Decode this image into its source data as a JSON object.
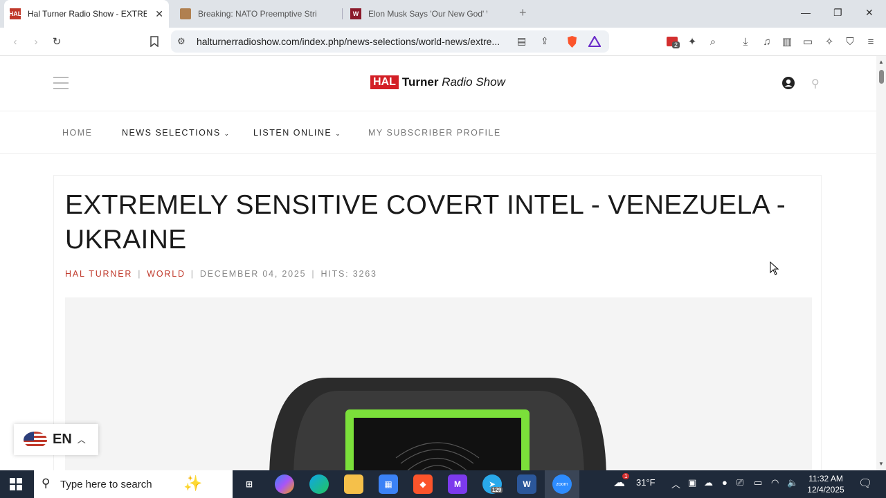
{
  "browser": {
    "tabs": [
      {
        "title": "Hal Turner Radio Show - EXTREMELY",
        "favicon": "HAL",
        "active": true
      },
      {
        "title": "Breaking: NATO Preemptive Strike on",
        "favicon": "",
        "active": false
      },
      {
        "title": "Elon Musk Says 'Our New God' Will C",
        "favicon": "W",
        "active": false
      }
    ],
    "url": "halturnerradioshow.com/index.php/news-selections/world-news/extre...",
    "extension_badge": "2"
  },
  "site": {
    "logo_box": "HAL",
    "logo_name": "Turner",
    "logo_suffix": "Radio Show",
    "nav": [
      {
        "label": "HOME"
      },
      {
        "label": "NEWS SELECTIONS"
      },
      {
        "label": "LISTEN ONLINE"
      },
      {
        "label": "MY SUBSCRIBER PROFILE"
      }
    ]
  },
  "article": {
    "title": "EXTREMELY SENSITIVE COVERT INTEL - VENEZUELA - UKRAINE",
    "author": "HAL TURNER",
    "category": "WORLD",
    "date": "DECEMBER 04, 2025",
    "hits": "HITS: 3263"
  },
  "language_widget": {
    "code": "EN"
  },
  "taskbar": {
    "search_placeholder": "Type here to search",
    "temperature": "31°F",
    "time": "11:32 AM",
    "date": "12/4/2025",
    "telegram_badge": "129",
    "weather_badge": "1",
    "zoom_label": "zoom"
  },
  "colors": {
    "brand_red": "#d31f26",
    "meta_red": "#c0392b",
    "screen_green": "#7be03a"
  }
}
